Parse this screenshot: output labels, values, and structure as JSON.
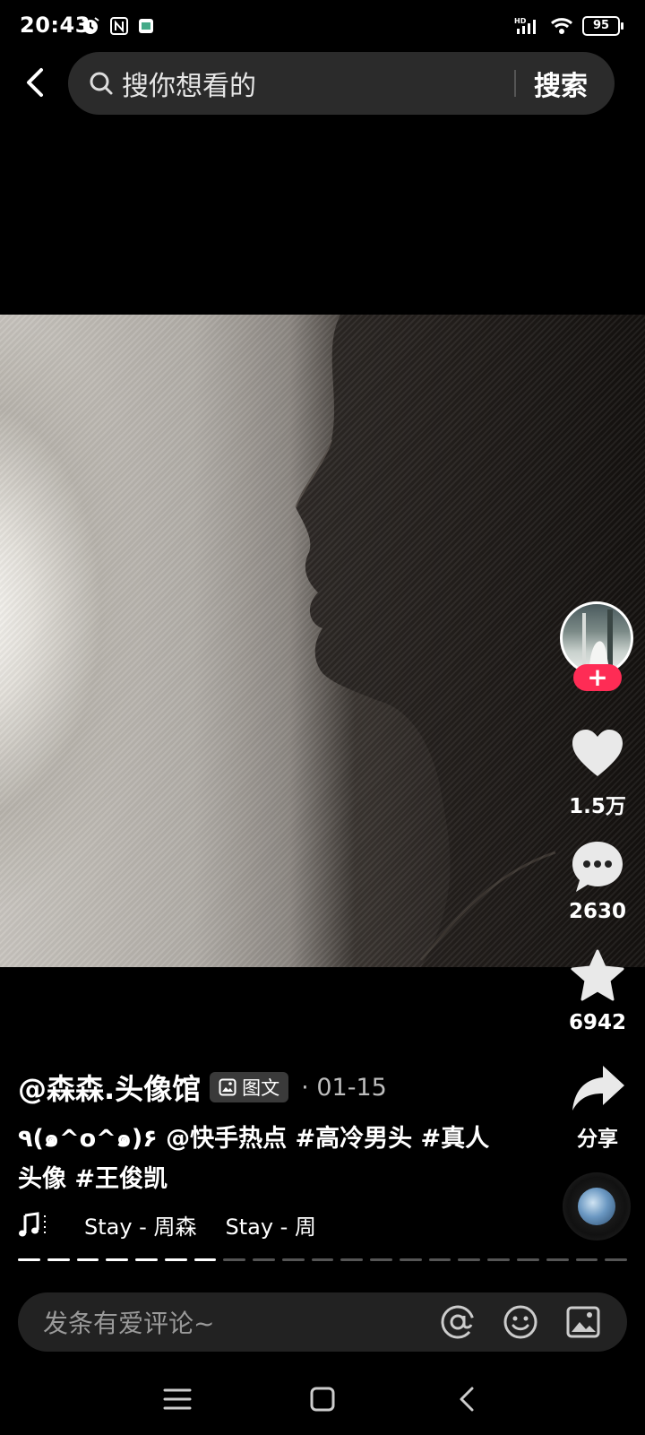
{
  "status_bar": {
    "time": "20:43",
    "battery": "95"
  },
  "search": {
    "placeholder": "搜你想看的",
    "button": "搜索"
  },
  "post": {
    "author": "@森森.头像馆",
    "type_badge": "图文",
    "separator": "·",
    "date": "01-15",
    "caption": "٩(๑^o^๑)۶ @快手热点 #高冷男头 #真人头像 #王俊凯",
    "music_tracks": [
      "Stay - 周森",
      "Stay - 周"
    ],
    "progress_total_segments": 21,
    "progress_current_segment": 7
  },
  "rail": {
    "follow": "+",
    "likes": "1.5万",
    "comments": "2630",
    "favorites": "6942",
    "share": "分享"
  },
  "comment_bar": {
    "placeholder": "发条有爱评论~"
  },
  "colors": {
    "follow_accent": "#fe2c55",
    "background": "#000000"
  }
}
